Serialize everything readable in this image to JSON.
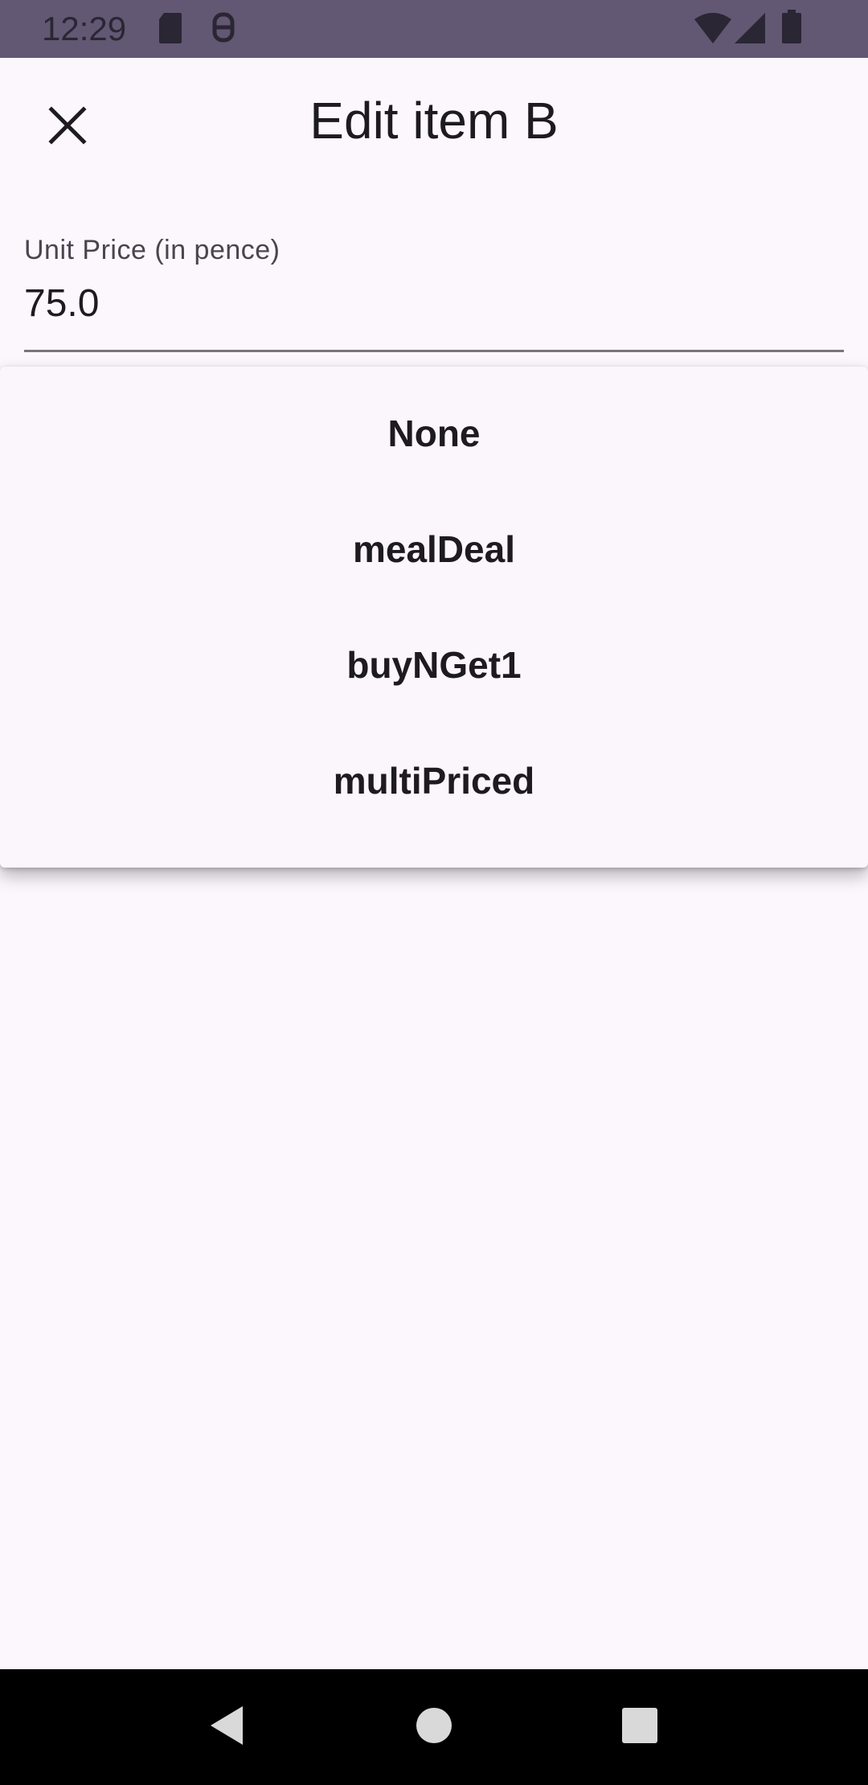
{
  "status_bar": {
    "time": "12:29",
    "left_icons": [
      "sd-card-icon",
      "notification-icon"
    ],
    "right_icons": [
      "wifi-icon",
      "cellular-signal-icon",
      "battery-icon"
    ]
  },
  "app_bar": {
    "title": "Edit item B",
    "close_icon": "close-icon"
  },
  "price_field": {
    "label": "Unit Price (in pence)",
    "value": "75.0"
  },
  "dropdown": {
    "options": [
      "None",
      "mealDeal",
      "buyNGet1",
      "multiPriced"
    ]
  },
  "nav_bar": {
    "buttons": [
      "back-icon",
      "home-icon",
      "recents-icon"
    ]
  },
  "colors": {
    "status_bar": "#625873",
    "background": "#fcf7fd",
    "menu_surface": "#fbf5fc",
    "text": "#1d1b20",
    "nav_bar": "#000000"
  }
}
